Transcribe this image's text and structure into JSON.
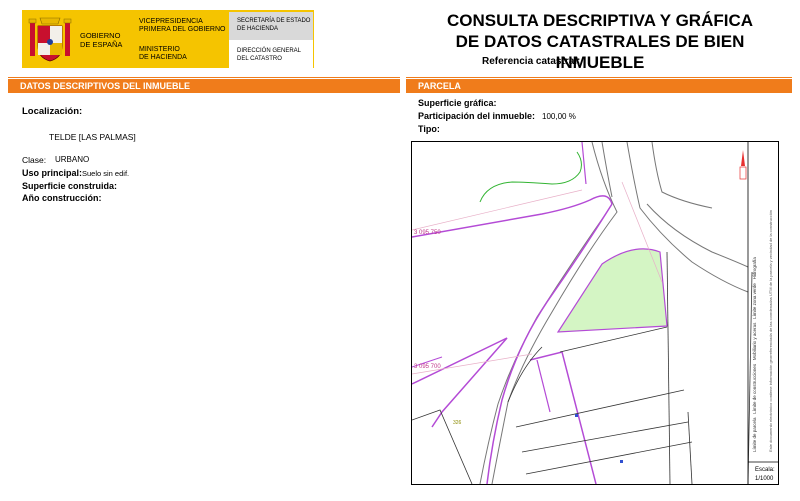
{
  "header": {
    "gov_line1": "GOBIERNO",
    "gov_line2": "DE ESPAÑA",
    "vice_line1": "VICEPRESIDENCIA",
    "vice_line2": "PRIMERA DEL GOBIERNO",
    "min_line1": "MINISTERIO",
    "min_line2": "DE HACIENDA",
    "sec_line1": "SECRETARÍA DE ESTADO",
    "sec_line2": "DE HACIENDA",
    "dir_line1": "DIRECCIÓN GENERAL",
    "dir_line2": "DEL CATASTRO",
    "title_line1": "CONSULTA DESCRIPTIVA Y GRÁFICA",
    "title_line2": "DE DATOS CATASTRALES DE BIEN INMUEBLE",
    "ref_label": "Referencia catastral:"
  },
  "left": {
    "bar_title": "DATOS DESCRIPTIVOS DEL INMUEBLE",
    "localizacion_label": "Localización:",
    "localizacion_value": "TELDE [LAS PALMAS]",
    "clase_label": "Clase:",
    "clase_value": "URBANO",
    "uso_label": "Uso principal:",
    "uso_value": "Suelo sin edif.",
    "superficie_label": "Superficie construida:",
    "anio_label": "Año construcción:"
  },
  "right": {
    "bar_title": "PARCELA",
    "sup_grafica_label": "Superficie gráfica:",
    "participacion_label": "Participación del inmueble:",
    "participacion_value": "100,00 %",
    "tipo_label": "Tipo:"
  },
  "map": {
    "coord1": "3 095 750",
    "coord2": "3 095 700",
    "parcel_num": "326",
    "escala_label": "Escala:",
    "escala_value": "1/1000",
    "legend_items": [
      "Límite de parcela",
      "Límite de construcciones",
      "Mobiliario y aceras",
      "Límite zona verde",
      "Hidrografía"
    ],
    "legend_note": "Este documento electrónico contiene información georreferenciada de las coordenadas UTM de la parcela y vecindad de la construcción",
    "colors": {
      "parcel_green": "#d4f5c4",
      "parcel_outline": "#b44bd6",
      "north": "#e83030"
    }
  }
}
